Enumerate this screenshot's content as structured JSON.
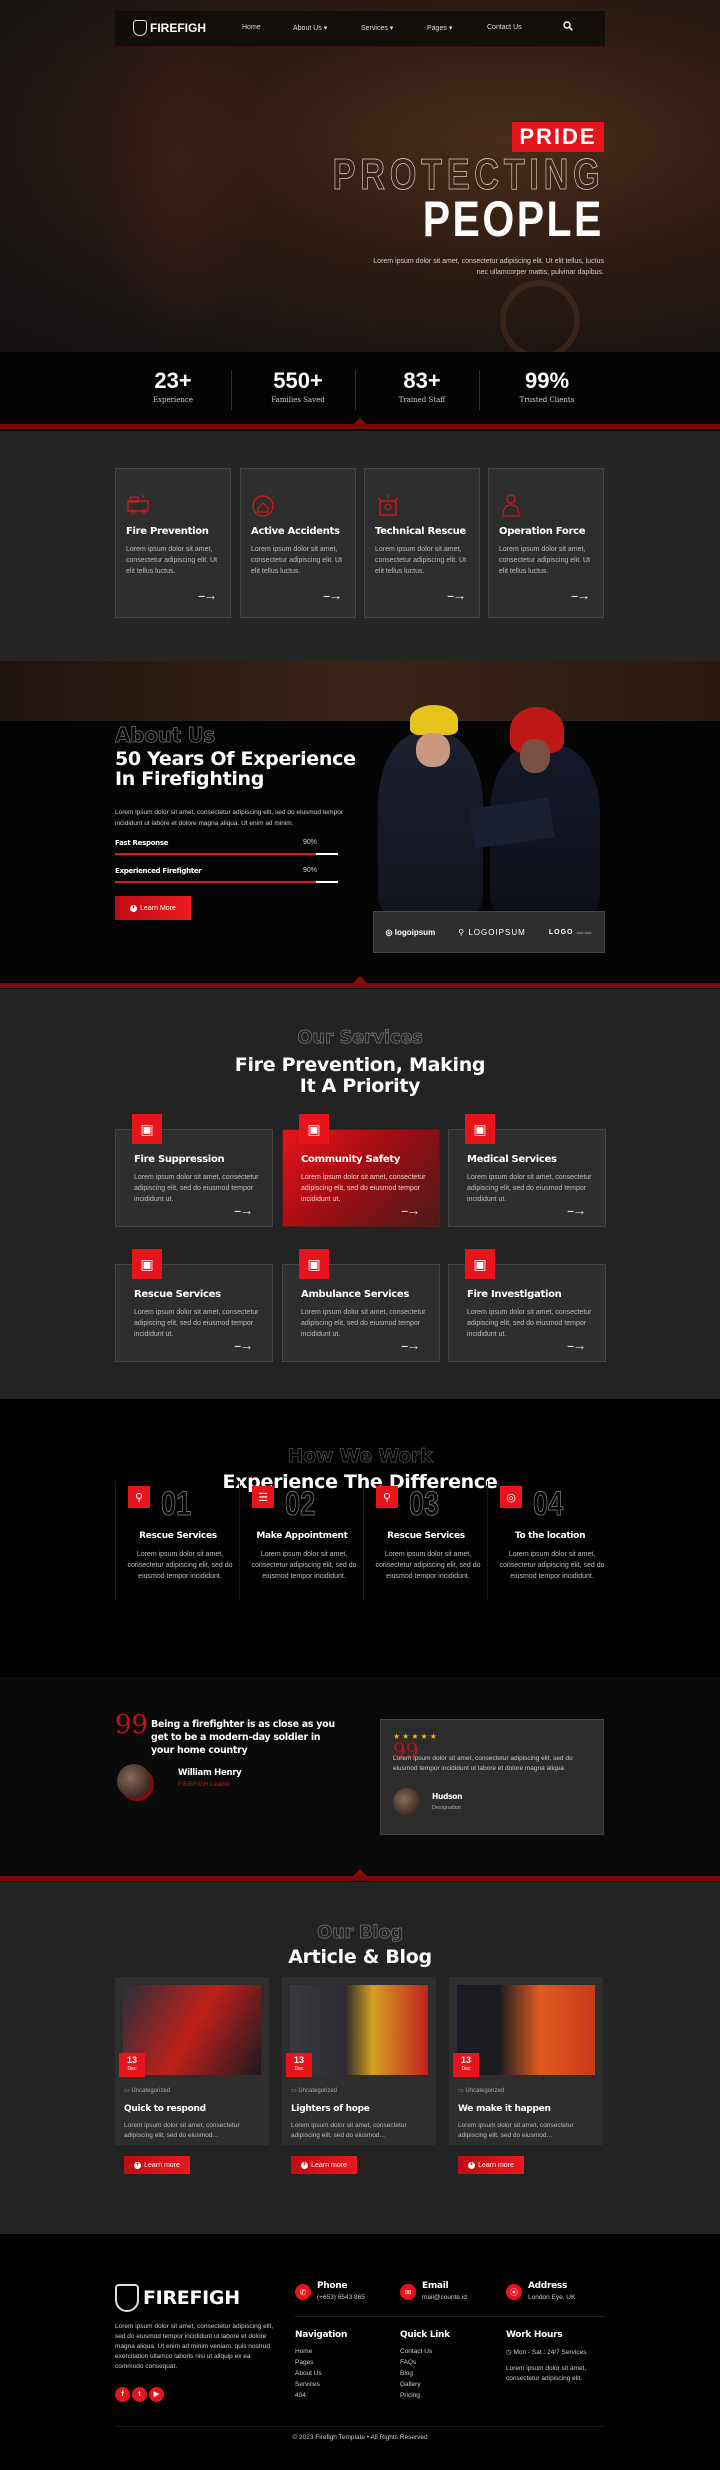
{
  "nav": {
    "logo_text": "FIREFIGH",
    "items": [
      {
        "label": "Home"
      },
      {
        "label": "About Us",
        "dropdown": true
      },
      {
        "label": "Services",
        "dropdown": true
      },
      {
        "label": "Pages",
        "dropdown": true
      },
      {
        "label": "Contact Us"
      }
    ],
    "search_icon": "search-icon",
    "chevron": "▾"
  },
  "hero": {
    "badge": "PRIDE",
    "outline_title": "PROTECTING",
    "title": "PEOPLE",
    "text": "Lorem ipsum dolor sit amet, consectetur adipiscing elit. Ut elit tellus, luctus nec ullamcorper mattis, pulvinar dapibus."
  },
  "stats": [
    {
      "value": "23+",
      "label": "Experience"
    },
    {
      "value": "550+",
      "label": "Families Saved"
    },
    {
      "value": "83+",
      "label": "Trained Staff"
    },
    {
      "value": "99%",
      "label": "Trusted Clients"
    }
  ],
  "features": [
    {
      "icon": "fire-truck-icon",
      "title": "Fire Prevention",
      "text": "Lorem ipsum dolor sit amet, consectetur adipiscing elit. Ut elit tellus luctus."
    },
    {
      "icon": "burning-house-icon",
      "title": "Active Accidents",
      "text": "Lorem ipsum dolor sit amet, consectetur adipiscing elit. Ut elit tellus luctus."
    },
    {
      "icon": "siren-icon",
      "title": "Technical Rescue",
      "text": "Lorem ipsum dolor sit amet, consectetur adipiscing elit. Ut elit tellus luctus."
    },
    {
      "icon": "firefighter-icon",
      "title": "Operation Force",
      "text": "Lorem ipsum dolor sit amet, consectetur adipiscing elit. Ut elit tellus luctus."
    }
  ],
  "arrow": "--→",
  "about": {
    "eyebrow": "About Us",
    "title_line1": "50 Years Of Experience",
    "title_line2": "In Firefighting",
    "text": "Lorem ipsum dolor sit amet, consectetur adipiscing elit, sed do eiusmod tempor incididunt ut labore et dolore magna aliqua. Ut enim ad minim.",
    "skills": [
      {
        "label": "Fast Response",
        "percent_text": "90%",
        "value": 90
      },
      {
        "label": "Experienced Firefighter",
        "percent_text": "90%",
        "value": 90
      }
    ],
    "button": "Learn More",
    "logos": [
      "logoipsum",
      "LOGOIPSUM",
      "LOGO"
    ]
  },
  "services": {
    "eyebrow": "Our Services",
    "title_line1": "Fire Prevention, Making",
    "title_line2": "It A Priority",
    "items": [
      {
        "icon": "fire-truck-icon",
        "title": "Fire Suppression",
        "text": "Lorem ipsum dolor sit amet, consectetur adipiscing elit, sed do eiusmod tempor incididunt ut.",
        "active": false
      },
      {
        "icon": "firefighter-icon",
        "title": "Community Safety",
        "text": "Lorem ipsum dolor sit amet, consectetur adipiscing elit, sed do eiusmod tempor incididunt ut.",
        "active": true
      },
      {
        "icon": "oxygen-tank-icon",
        "title": "Medical Services",
        "text": "Lorem ipsum dolor sit amet, consectetur adipiscing elit, sed do eiusmod tempor incididunt ut.",
        "active": false
      },
      {
        "icon": "shield-fire-icon",
        "title": "Rescue Services",
        "text": "Lorem ipsum dolor sit amet, consectetur adipiscing elit, sed do eiusmod tempor incididunt ut.",
        "active": false
      },
      {
        "icon": "first-aid-kit-icon",
        "title": "Ambulance Services",
        "text": "Lorem ipsum dolor sit amet, consectetur adipiscing elit, sed do eiusmod tempor incididunt ut.",
        "active": false
      },
      {
        "icon": "extinguisher-icon",
        "title": "Fire Investigation",
        "text": "Lorem ipsum dolor sit amet, consectetur adipiscing elit, sed do eiusmod tempor incididunt ut.",
        "active": false
      }
    ]
  },
  "how": {
    "eyebrow": "How We Work",
    "title": "Experience The Difference",
    "steps": [
      {
        "icon": "search-icon",
        "num": "01",
        "title": "Rescue Services",
        "text": "Lorem ipsum dolor sit amet, consectetur adipiscing elit, sed do eiusmod tempor incididunt."
      },
      {
        "icon": "list-icon",
        "num": "02",
        "title": "Make Appointment",
        "text": "Lorem ipsum dolor sit amet, consectetur adipiscing elit, sed do eiusmod tempor incididunt."
      },
      {
        "icon": "search-icon",
        "num": "03",
        "title": "Rescue Services",
        "text": "Lorem ipsum dolor sit amet, consectetur adipiscing elit, sed do eiusmod tempor incididunt."
      },
      {
        "icon": "target-icon",
        "num": "04",
        "title": "To the location",
        "text": "Lorem ipsum dolor sit amet, consectetur adipiscing elit, sed do eiusmod tempor incididunt."
      }
    ]
  },
  "testimonial": {
    "quote_mark": "99",
    "quote": "Being a firefighter is as close as you get to be a modern-day soldier in your home country",
    "author": "William Henry",
    "author_role": "FIREFIGH Leader",
    "card": {
      "stars": "★★★★★",
      "rating": 5,
      "text": "Lorem ipsum dolor sit amet, consectetur adipiscing elit, sed do eiusmod tempor incididunt ut labore et dolore magna aliqua",
      "name": "Hudson",
      "role": "Designation"
    }
  },
  "blog": {
    "eyebrow": "Our Blog",
    "title": "Article & Blog",
    "posts": [
      {
        "day": "13",
        "month": "Dec",
        "category": "Uncategorized",
        "title": "Quick to respond",
        "text": "Lorem ipsum dolor sit amet, consectetur adipiscing elit, sed do eiusmod...",
        "button": "Learn more"
      },
      {
        "day": "13",
        "month": "Dec",
        "category": "Uncategorized",
        "title": "Lighters of hope",
        "text": "Lorem ipsum dolor sit amet, consectetur adipiscing elit, sed do eiusmod...",
        "button": "Learn more"
      },
      {
        "day": "13",
        "month": "Dec",
        "category": "Uncategorized",
        "title": "We make it happen",
        "text": "Lorem ipsum dolor sit amet, consectetur adipiscing elit, sed do eiusmod...",
        "button": "Learn more"
      }
    ]
  },
  "footer": {
    "logo_text": "FIREFIGH",
    "about": "Lorem ipsum dolor sit amet, consectetur adipiscing elit, sed do eiusmod tempor incididunt ut labore et dolore magna aliqua. Ut enim ad minim veniam, quis nostrud exercitation ullamco laboris nisi ut aliquip ex ea commodo consequat.",
    "contacts": [
      {
        "icon": "phone-icon",
        "label": "Phone",
        "value": "(+653) 6543 865"
      },
      {
        "icon": "email-icon",
        "label": "Email",
        "value": "mail@counte.id"
      },
      {
        "icon": "location-icon",
        "label": "Address",
        "value": "London Eye, UK"
      }
    ],
    "navigation": {
      "title": "Navigation",
      "links": [
        "Home",
        "Pages",
        "About Us",
        "Services",
        "404"
      ]
    },
    "quick_links": {
      "title": "Quick Link",
      "links": [
        "Contact Us",
        "FAQs",
        "Blog",
        "Gallery",
        "Pricing"
      ]
    },
    "work_hours": {
      "title": "Work Hours",
      "hours": "Mon - Sat : 24/7 Services",
      "text": "Lorem ipsum dolor sit amet, consectetur adipiscing elit."
    },
    "social": [
      {
        "icon": "facebook-icon",
        "glyph": "f"
      },
      {
        "icon": "twitter-icon",
        "glyph": "t"
      },
      {
        "icon": "youtube-icon",
        "glyph": "▶"
      }
    ],
    "copyright": "© 2023 Firefigh Template • All Rights Reserved"
  },
  "colors": {
    "accent": "#e8141c",
    "dark_red": "#7a0a0a",
    "card": "#2e2e2e",
    "section": "#232323"
  }
}
